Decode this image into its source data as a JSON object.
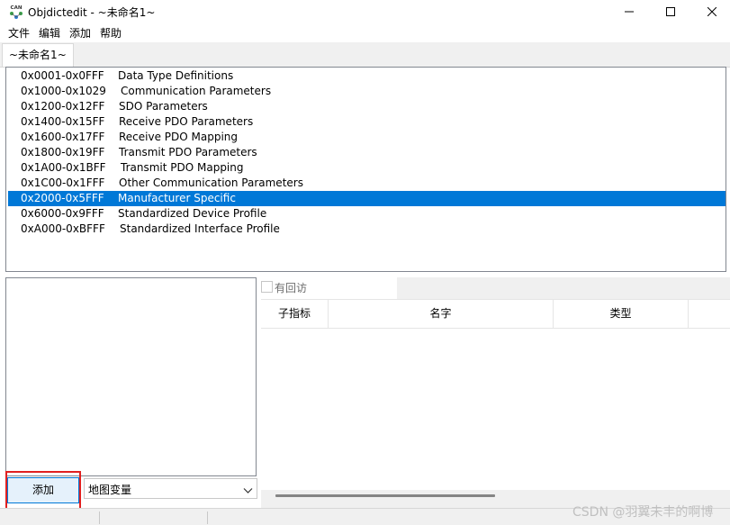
{
  "window": {
    "title": "Objdictedit - ~未命名1~",
    "icon_label": "CAN"
  },
  "menu": [
    "文件",
    "编辑",
    "添加",
    "帮助"
  ],
  "tab": {
    "label": "~未命名1~"
  },
  "index_ranges": [
    {
      "code": "0x0001-0x0FFF",
      "name": "Data Type Definitions"
    },
    {
      "code": "0x1000-0x1029",
      "name": "Communication Parameters"
    },
    {
      "code": "0x1200-0x12FF",
      "name": "SDO Parameters"
    },
    {
      "code": "0x1400-0x15FF",
      "name": "Receive PDO Parameters"
    },
    {
      "code": "0x1600-0x17FF",
      "name": "Receive PDO Mapping"
    },
    {
      "code": "0x1800-0x19FF",
      "name": "Transmit PDO Parameters"
    },
    {
      "code": "0x1A00-0x1BFF",
      "name": "Transmit PDO Mapping"
    },
    {
      "code": "0x1C00-0x1FFF",
      "name": "Other Communication Parameters"
    },
    {
      "code": "0x2000-0x5FFF",
      "name": "Manufacturer Specific",
      "selected": true
    },
    {
      "code": "0x6000-0x9FFF",
      "name": "Standardized Device Profile"
    },
    {
      "code": "0xA000-0xBFFF",
      "name": "Standardized Interface Profile"
    }
  ],
  "callback": {
    "label": "有回访",
    "checked": false
  },
  "table": {
    "columns": [
      "子指标",
      "名字",
      "类型"
    ]
  },
  "add_button": {
    "label": "添加"
  },
  "add_type_select": {
    "value": "地图变量"
  },
  "watermark": "CSDN @羽翼未丰的啊博",
  "colors": {
    "selection": "#0078d7",
    "highlight_box": "#e02020"
  }
}
